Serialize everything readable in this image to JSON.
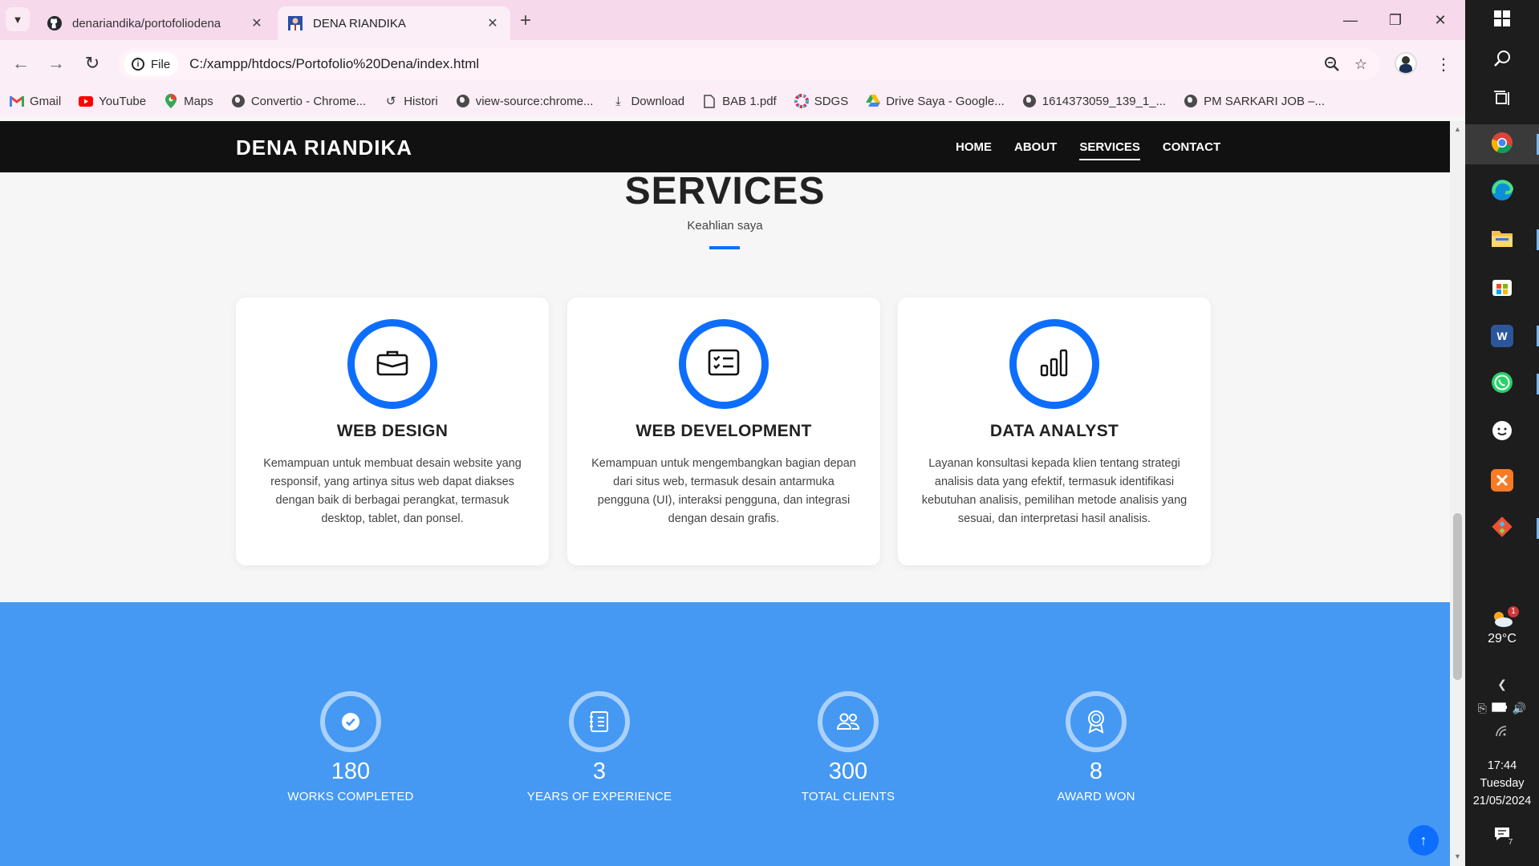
{
  "browser": {
    "tabs": [
      {
        "title": "denariandika/portofoliodena",
        "icon": "github-icon",
        "active": false
      },
      {
        "title": "DENA RIANDIKA",
        "icon": "profile-photo-icon",
        "active": true
      }
    ],
    "address": {
      "scheme_label": "File",
      "url": "C:/xampp/htdocs/Portofolio%20Dena/index.html"
    },
    "bookmarks": [
      {
        "label": "Gmail",
        "icon": "gmail-icon"
      },
      {
        "label": "YouTube",
        "icon": "youtube-icon"
      },
      {
        "label": "Maps",
        "icon": "maps-icon"
      },
      {
        "label": "Convertio - Chrome...",
        "icon": "globe-icon"
      },
      {
        "label": "Histori",
        "icon": "history-icon"
      },
      {
        "label": "view-source:chrome...",
        "icon": "globe-icon"
      },
      {
        "label": "Download",
        "icon": "download-icon"
      },
      {
        "label": "BAB 1.pdf",
        "icon": "file-icon"
      },
      {
        "label": "SDGS",
        "icon": "sdgs-icon"
      },
      {
        "label": "Drive Saya - Google...",
        "icon": "drive-icon"
      },
      {
        "label": "1614373059_139_1_...",
        "icon": "globe-icon"
      },
      {
        "label": "PM SARKARI JOB –...",
        "icon": "globe-icon"
      }
    ]
  },
  "site": {
    "brand": "DENA RIANDIKA",
    "menu": [
      {
        "label": "HOME",
        "active": false
      },
      {
        "label": "ABOUT",
        "active": false
      },
      {
        "label": "SERVICES",
        "active": true
      },
      {
        "label": "CONTACT",
        "active": false
      }
    ],
    "accent_color": "#0d6efd",
    "counter_bg_color": "#4599f3"
  },
  "services": {
    "title": "SERVICES",
    "subtitle": "Keahlian saya",
    "cards": [
      {
        "icon": "briefcase-icon",
        "title": "WEB DESIGN",
        "description": "Kemampuan untuk membuat desain website yang responsif, yang artinya situs web dapat diakses dengan baik di berbagai perangkat, termasuk desktop, tablet, dan ponsel."
      },
      {
        "icon": "card-checklist-icon",
        "title": "WEB DEVELOPMENT",
        "description": "Kemampuan untuk mengembangkan bagian depan dari situs web, termasuk desain antarmuka pengguna (UI), interaksi pengguna, dan integrasi dengan desain grafis."
      },
      {
        "icon": "bar-chart-icon",
        "title": "DATA ANALYST",
        "description": "Layanan konsultasi kepada klien tentang strategi analisis data yang efektif, termasuk identifikasi kebutuhan analisis, pemilihan metode analisis yang sesuai, dan interpretasi hasil analisis."
      }
    ]
  },
  "counters": [
    {
      "icon": "check-icon",
      "number": "180",
      "label": "WORKS COMPLETED"
    },
    {
      "icon": "journal-icon",
      "number": "3",
      "label": "YEARS OF EXPERIENCE"
    },
    {
      "icon": "people-icon",
      "number": "300",
      "label": "TOTAL CLIENTS"
    },
    {
      "icon": "award-icon",
      "number": "8",
      "label": "AWARD WON"
    }
  ],
  "taskbar": {
    "apps": [
      "chrome-icon",
      "edge-icon",
      "file-explorer-icon",
      "store-icon",
      "word-icon",
      "whatsapp-icon",
      "emoji-icon",
      "xampp-icon",
      "git-icon"
    ],
    "weather": {
      "temp": "29°C",
      "badge": "1"
    },
    "clock": {
      "time": "17:44",
      "day": "Tuesday",
      "date": "21/05/2024"
    },
    "notification_count": "7"
  }
}
